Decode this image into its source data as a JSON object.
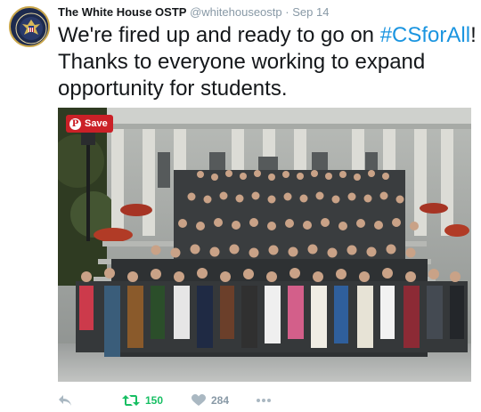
{
  "tweet": {
    "author_name": "The White House OSTP",
    "handle": "@whitehouseostp",
    "separator": "·",
    "date": "Sep 14",
    "text_before": "We're fired up and ready to go on ",
    "hashtag": "#CSforAll",
    "text_after": "! Thanks to everyone working to expand opportunity for students."
  },
  "media": {
    "save_label": "Save",
    "save_icon_glyph": "P",
    "save_color": "#cb2027"
  },
  "actions": {
    "reply_icon": "reply-icon",
    "retweet_icon": "retweet-icon",
    "retweet_count": "150",
    "retweet_color": "#17bf63",
    "like_icon": "heart-icon",
    "like_count": "284",
    "more_icon": "more-dots-icon"
  },
  "colors": {
    "text": "#14171a",
    "muted": "#8899a6",
    "hashtag": "#1b95e0"
  }
}
